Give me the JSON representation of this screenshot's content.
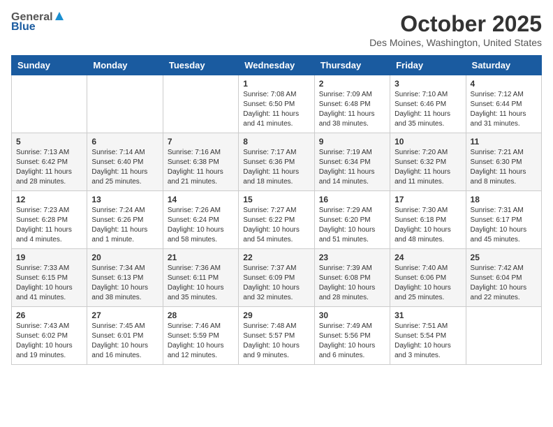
{
  "header": {
    "logo_general": "General",
    "logo_blue": "Blue",
    "month_title": "October 2025",
    "location": "Des Moines, Washington, United States"
  },
  "weekdays": [
    "Sunday",
    "Monday",
    "Tuesday",
    "Wednesday",
    "Thursday",
    "Friday",
    "Saturday"
  ],
  "weeks": [
    [
      {
        "day": "",
        "info": ""
      },
      {
        "day": "",
        "info": ""
      },
      {
        "day": "",
        "info": ""
      },
      {
        "day": "1",
        "info": "Sunrise: 7:08 AM\nSunset: 6:50 PM\nDaylight: 11 hours\nand 41 minutes."
      },
      {
        "day": "2",
        "info": "Sunrise: 7:09 AM\nSunset: 6:48 PM\nDaylight: 11 hours\nand 38 minutes."
      },
      {
        "day": "3",
        "info": "Sunrise: 7:10 AM\nSunset: 6:46 PM\nDaylight: 11 hours\nand 35 minutes."
      },
      {
        "day": "4",
        "info": "Sunrise: 7:12 AM\nSunset: 6:44 PM\nDaylight: 11 hours\nand 31 minutes."
      }
    ],
    [
      {
        "day": "5",
        "info": "Sunrise: 7:13 AM\nSunset: 6:42 PM\nDaylight: 11 hours\nand 28 minutes."
      },
      {
        "day": "6",
        "info": "Sunrise: 7:14 AM\nSunset: 6:40 PM\nDaylight: 11 hours\nand 25 minutes."
      },
      {
        "day": "7",
        "info": "Sunrise: 7:16 AM\nSunset: 6:38 PM\nDaylight: 11 hours\nand 21 minutes."
      },
      {
        "day": "8",
        "info": "Sunrise: 7:17 AM\nSunset: 6:36 PM\nDaylight: 11 hours\nand 18 minutes."
      },
      {
        "day": "9",
        "info": "Sunrise: 7:19 AM\nSunset: 6:34 PM\nDaylight: 11 hours\nand 14 minutes."
      },
      {
        "day": "10",
        "info": "Sunrise: 7:20 AM\nSunset: 6:32 PM\nDaylight: 11 hours\nand 11 minutes."
      },
      {
        "day": "11",
        "info": "Sunrise: 7:21 AM\nSunset: 6:30 PM\nDaylight: 11 hours\nand 8 minutes."
      }
    ],
    [
      {
        "day": "12",
        "info": "Sunrise: 7:23 AM\nSunset: 6:28 PM\nDaylight: 11 hours\nand 4 minutes."
      },
      {
        "day": "13",
        "info": "Sunrise: 7:24 AM\nSunset: 6:26 PM\nDaylight: 11 hours\nand 1 minute."
      },
      {
        "day": "14",
        "info": "Sunrise: 7:26 AM\nSunset: 6:24 PM\nDaylight: 10 hours\nand 58 minutes."
      },
      {
        "day": "15",
        "info": "Sunrise: 7:27 AM\nSunset: 6:22 PM\nDaylight: 10 hours\nand 54 minutes."
      },
      {
        "day": "16",
        "info": "Sunrise: 7:29 AM\nSunset: 6:20 PM\nDaylight: 10 hours\nand 51 minutes."
      },
      {
        "day": "17",
        "info": "Sunrise: 7:30 AM\nSunset: 6:18 PM\nDaylight: 10 hours\nand 48 minutes."
      },
      {
        "day": "18",
        "info": "Sunrise: 7:31 AM\nSunset: 6:17 PM\nDaylight: 10 hours\nand 45 minutes."
      }
    ],
    [
      {
        "day": "19",
        "info": "Sunrise: 7:33 AM\nSunset: 6:15 PM\nDaylight: 10 hours\nand 41 minutes."
      },
      {
        "day": "20",
        "info": "Sunrise: 7:34 AM\nSunset: 6:13 PM\nDaylight: 10 hours\nand 38 minutes."
      },
      {
        "day": "21",
        "info": "Sunrise: 7:36 AM\nSunset: 6:11 PM\nDaylight: 10 hours\nand 35 minutes."
      },
      {
        "day": "22",
        "info": "Sunrise: 7:37 AM\nSunset: 6:09 PM\nDaylight: 10 hours\nand 32 minutes."
      },
      {
        "day": "23",
        "info": "Sunrise: 7:39 AM\nSunset: 6:08 PM\nDaylight: 10 hours\nand 28 minutes."
      },
      {
        "day": "24",
        "info": "Sunrise: 7:40 AM\nSunset: 6:06 PM\nDaylight: 10 hours\nand 25 minutes."
      },
      {
        "day": "25",
        "info": "Sunrise: 7:42 AM\nSunset: 6:04 PM\nDaylight: 10 hours\nand 22 minutes."
      }
    ],
    [
      {
        "day": "26",
        "info": "Sunrise: 7:43 AM\nSunset: 6:02 PM\nDaylight: 10 hours\nand 19 minutes."
      },
      {
        "day": "27",
        "info": "Sunrise: 7:45 AM\nSunset: 6:01 PM\nDaylight: 10 hours\nand 16 minutes."
      },
      {
        "day": "28",
        "info": "Sunrise: 7:46 AM\nSunset: 5:59 PM\nDaylight: 10 hours\nand 12 minutes."
      },
      {
        "day": "29",
        "info": "Sunrise: 7:48 AM\nSunset: 5:57 PM\nDaylight: 10 hours\nand 9 minutes."
      },
      {
        "day": "30",
        "info": "Sunrise: 7:49 AM\nSunset: 5:56 PM\nDaylight: 10 hours\nand 6 minutes."
      },
      {
        "day": "31",
        "info": "Sunrise: 7:51 AM\nSunset: 5:54 PM\nDaylight: 10 hours\nand 3 minutes."
      },
      {
        "day": "",
        "info": ""
      }
    ]
  ]
}
